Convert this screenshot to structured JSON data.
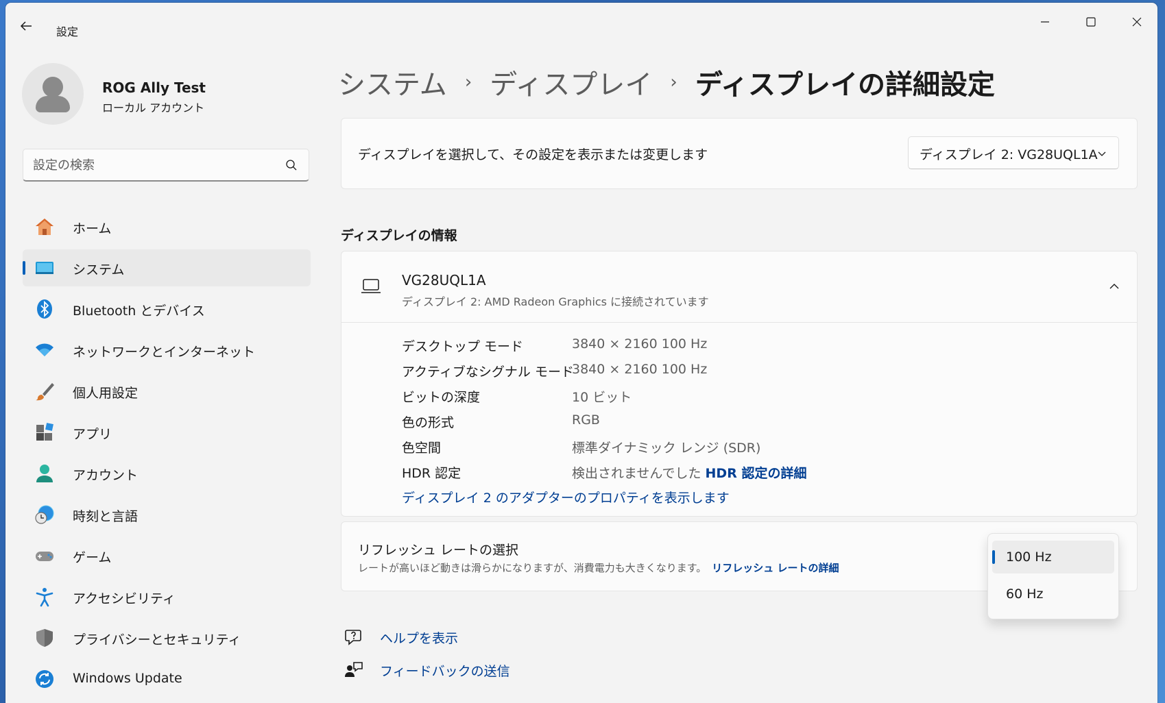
{
  "window": {
    "title": "設定",
    "controls": [
      "minimize-icon",
      "maximize-icon",
      "close-icon"
    ]
  },
  "profile": {
    "name": "ROG Ally Test",
    "account_type": "ローカル アカウント"
  },
  "search": {
    "placeholder": "設定の検索"
  },
  "sidebar": {
    "items": [
      {
        "label": "ホーム",
        "icon": "home-icon"
      },
      {
        "label": "システム",
        "icon": "system-icon",
        "active": true
      },
      {
        "label": "Bluetooth とデバイス",
        "icon": "bluetooth-icon"
      },
      {
        "label": "ネットワークとインターネット",
        "icon": "wifi-icon"
      },
      {
        "label": "個人用設定",
        "icon": "brush-icon"
      },
      {
        "label": "アプリ",
        "icon": "apps-icon"
      },
      {
        "label": "アカウント",
        "icon": "account-icon"
      },
      {
        "label": "時刻と言語",
        "icon": "time-language-icon"
      },
      {
        "label": "ゲーム",
        "icon": "gamepad-icon"
      },
      {
        "label": "アクセシビリティ",
        "icon": "accessibility-icon"
      },
      {
        "label": "プライバシーとセキュリティ",
        "icon": "shield-icon"
      },
      {
        "label": "Windows Update",
        "icon": "update-icon"
      }
    ]
  },
  "breadcrumb": {
    "items": [
      "システム",
      "ディスプレイ"
    ],
    "current": "ディスプレイの詳細設定"
  },
  "display_select": {
    "label": "ディスプレイを選択して、その設定を表示または変更します",
    "value": "ディスプレイ 2: VG28UQL1A"
  },
  "display_info": {
    "section_title": "ディスプレイの情報",
    "monitor_name": "VG28UQL1A",
    "monitor_sub": "ディスプレイ 2: AMD Radeon Graphics に接続されています",
    "rows": [
      {
        "key": "デスクトップ モード",
        "value": "3840 × 2160 100 Hz"
      },
      {
        "key": "アクティブなシグナル モード",
        "value": "3840 × 2160 100 Hz"
      },
      {
        "key": "ビットの深度",
        "value": "10 ビット"
      },
      {
        "key": "色の形式",
        "value": "RGB"
      },
      {
        "key": "色空間",
        "value": "標準ダイナミック レンジ (SDR)"
      },
      {
        "key": "HDR 認定",
        "value": "検出されませんでした",
        "link": "HDR 認定の詳細"
      }
    ],
    "adapter_link": "ディスプレイ 2 のアダプターのプロパティを表示します"
  },
  "refresh_rate": {
    "title": "リフレッシュ レートの選択",
    "description": "レートが高いほど動きは滑らかになりますが、消費電力も大きくなります。",
    "link": "リフレッシュ レートの詳細",
    "options": [
      "100 Hz",
      "60 Hz"
    ],
    "selected": "100 Hz"
  },
  "footer_links": {
    "help": "ヘルプを表示",
    "feedback": "フィードバックの送信"
  },
  "colors": {
    "accent": "#005fb8",
    "link": "#003e92",
    "background": "#f3f3f3",
    "card": "#fbfbfb"
  }
}
